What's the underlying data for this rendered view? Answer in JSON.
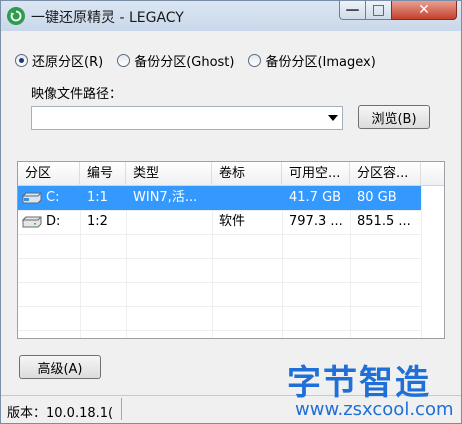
{
  "window": {
    "title": "一键还原精灵 - LEGACY"
  },
  "title_buttons": {
    "minimize": "—",
    "maximize": "□",
    "close": "✕"
  },
  "mode": {
    "options": [
      {
        "label": "还原分区(R)",
        "selected": true
      },
      {
        "label": "备份分区(Ghost)",
        "selected": false
      },
      {
        "label": "备份分区(Imagex)",
        "selected": false
      }
    ]
  },
  "image_path": {
    "label": "映像文件路径：",
    "value": "",
    "browse_label": "浏览(B)"
  },
  "table": {
    "headers": [
      "分区",
      "编号",
      "类型",
      "卷标",
      "可用空...",
      "分区容..."
    ],
    "rows": [
      {
        "drive": "C:",
        "number": "1:1",
        "type": "WIN7,活...",
        "label": "",
        "free": "41.7 GB",
        "size": "80 GB",
        "selected": true
      },
      {
        "drive": "D:",
        "number": "1:2",
        "type": "",
        "label": "软件",
        "free": "797.3 ...",
        "size": "851.5 ...",
        "selected": false
      }
    ]
  },
  "advanced_button": "高级(A)",
  "status": {
    "version": "版本：10.0.18.1("
  },
  "watermark": {
    "title": "字节智造",
    "url": "www.zsxcool.com"
  },
  "colors": {
    "selection": "#3399ff",
    "watermark": "#1f6fd6",
    "app_icon": "#2e9b4d"
  }
}
